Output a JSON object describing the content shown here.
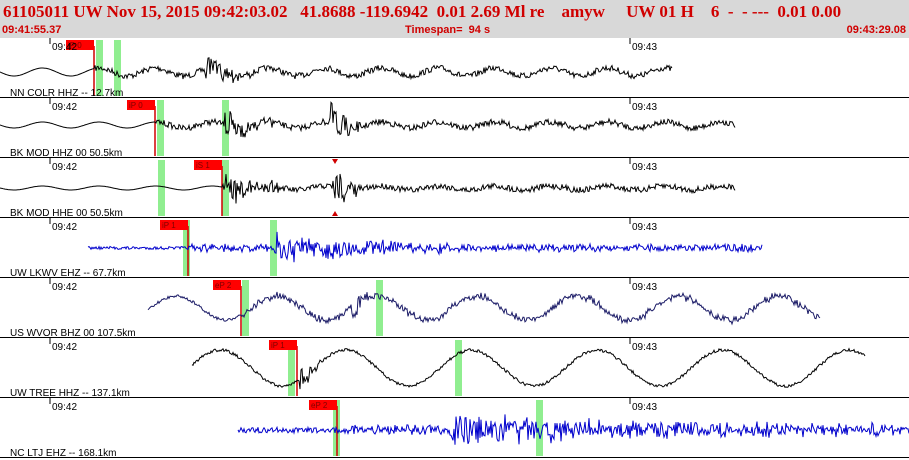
{
  "header": {
    "title": "61105011 UW Nov 15, 2015 09:42:03.02   41.8688 -119.6942  0.01 2.69 Ml re    amyw     UW 01 H    6  -  - ---  0.01 0.00",
    "time_start": "09:41:55.37",
    "timespan": "Timespan=  94 s",
    "time_end": "09:43:29.08"
  },
  "colors": {
    "title": "#d00000",
    "pick_box": "#ff0000",
    "marker_green": "#90ee90",
    "trace_black": "#000000",
    "trace_blue": "#0000d0",
    "header_bg": "#d8d8d8"
  },
  "channels": [
    {
      "label": "NN COLR HHZ -- 12.7km",
      "tick_a": "09:42",
      "tick_b": "09:43",
      "color": "black",
      "pick": "iP 0",
      "pick_label_2": ""
    },
    {
      "label": "BK MOD HHZ 00 50.5km",
      "tick_a": "09:42",
      "tick_b": "09:43",
      "color": "black",
      "pick": "iP 0",
      "pick_label_2": ""
    },
    {
      "label": "BK MOD HHE 00 50.5km",
      "tick_a": "09:42",
      "tick_b": "09:43",
      "color": "black",
      "pick": "iS 1",
      "pick_label_2": ""
    },
    {
      "label": "UW LKWV EHZ -- 67.7km",
      "tick_a": "09:42",
      "tick_b": "09:43",
      "color": "blue",
      "pick": "iP 1",
      "pick_label_2": ""
    },
    {
      "label": "US WVOR BHZ 00 107.5km",
      "tick_a": "09:42",
      "tick_b": "09:43",
      "color": "navy",
      "pick": "eP 2",
      "pick_label_2": ""
    },
    {
      "label": "UW TREE HHZ -- 137.1km",
      "tick_a": "09:42",
      "tick_b": "09:43",
      "color": "black",
      "pick": "iP 1",
      "pick_label_2": ""
    },
    {
      "label": "NC LTJ EHZ -- 168.1km",
      "tick_a": "09:42",
      "tick_b": "09:43",
      "color": "blue",
      "pick": "eP 2",
      "pick_label_2": ""
    }
  ]
}
